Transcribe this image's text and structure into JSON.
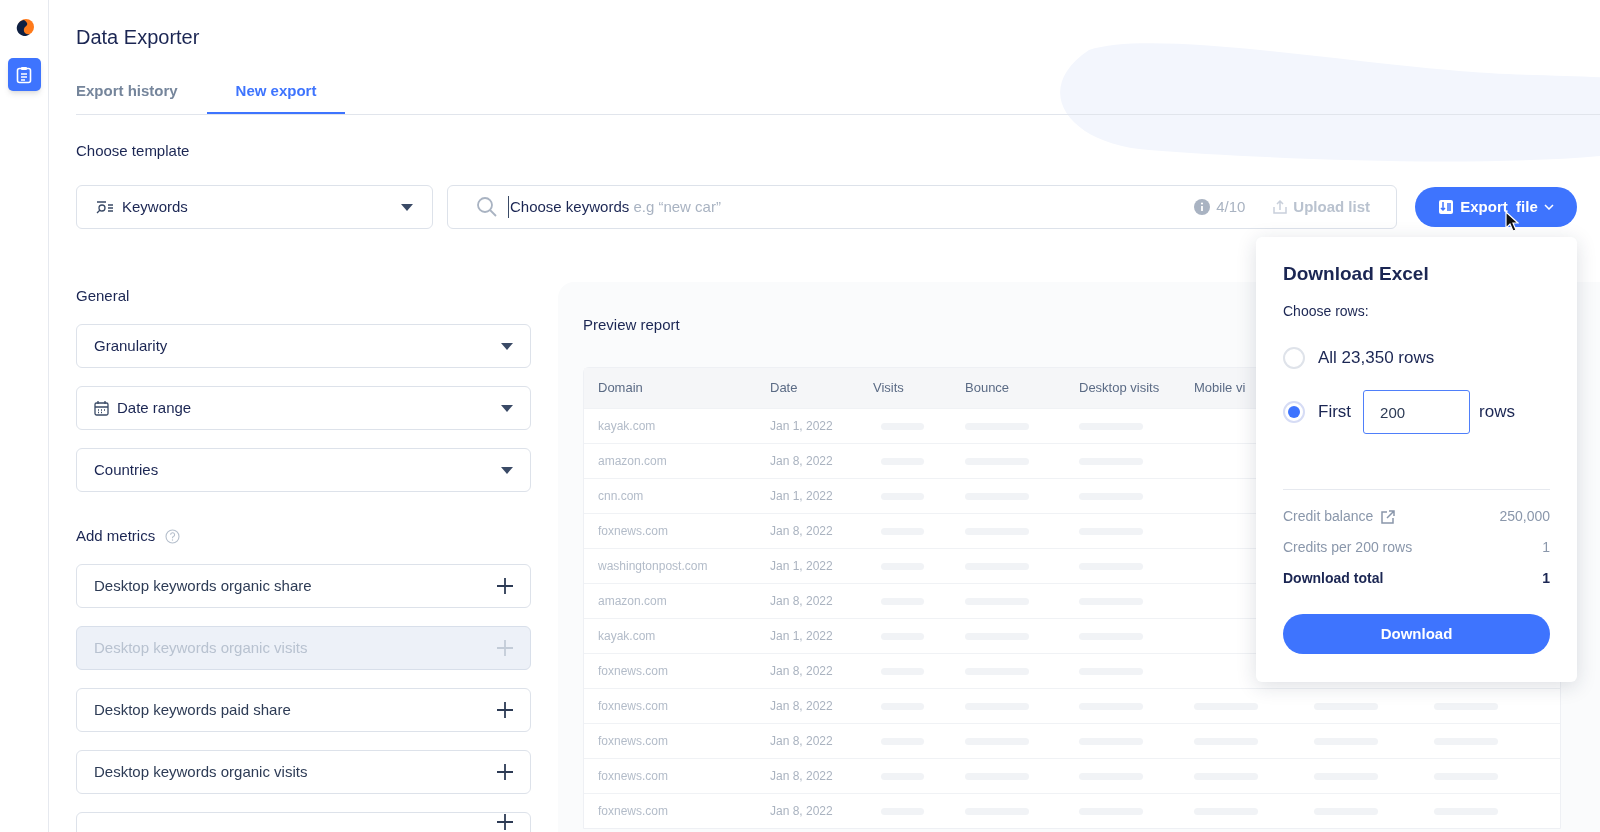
{
  "sidebar": {
    "items": [
      {
        "selected": true
      }
    ]
  },
  "title": "Data Exporter",
  "tabs": [
    {
      "label": "Export history",
      "selected": false
    },
    {
      "label": "New export",
      "selected": true
    }
  ],
  "template": {
    "label": "Choose template",
    "dropdown": {
      "value": "Keywords"
    },
    "search": {
      "placeholder": "Choose keywords",
      "hint": "e.g “new car”",
      "counter": "4/10",
      "upload": {
        "label": "Upload list",
        "disabled": true
      }
    },
    "export_button": "Export  file"
  },
  "general": {
    "label": "General",
    "filters": [
      {
        "label": "Granularity",
        "kind": "plain"
      },
      {
        "label": "Date range",
        "kind": "date"
      },
      {
        "label": "Countries",
        "kind": "plain"
      }
    ]
  },
  "metrics": {
    "label": "Add metrics",
    "items": [
      {
        "label": "Desktop keywords organic share",
        "disabled": false
      },
      {
        "label": "Desktop keywords organic visits",
        "disabled": true
      },
      {
        "label": "Desktop keywords paid share",
        "disabled": false
      },
      {
        "label": "Desktop keywords organic visits",
        "disabled": false
      },
      {
        "disabled": false
      }
    ]
  },
  "preview": {
    "title": "Preview report",
    "columns": [
      "Domain",
      "Date",
      "Visits",
      "Bounce",
      "Desktop visits",
      "Mobile vi"
    ],
    "rows": [
      {
        "domain": "kayak.com",
        "date": "Jan 1, 2022"
      },
      {
        "domain": "amazon.com",
        "date": "Jan 8, 2022"
      },
      {
        "domain": "cnn.com",
        "date": "Jan 1, 2022"
      },
      {
        "domain": "foxnews.com",
        "date": "Jan 8, 2022"
      },
      {
        "domain": "washingtonpost.com",
        "date": "Jan 1, 2022"
      },
      {
        "domain": "amazon.com",
        "date": "Jan 8, 2022"
      },
      {
        "domain": "kayak.com",
        "date": "Jan 1, 2022"
      },
      {
        "domain": "foxnews.com",
        "date": "Jan 8, 2022"
      },
      {
        "domain": "foxnews.com",
        "date": "Jan 8, 2022"
      },
      {
        "domain": "foxnews.com",
        "date": "Jan 8, 2022"
      },
      {
        "domain": "foxnews.com",
        "date": "Jan 8, 2022"
      },
      {
        "domain": "foxnews.com",
        "date": "Jan 8, 2022"
      }
    ]
  },
  "popup": {
    "title": "Download Excel",
    "choose_label": "Choose rows:",
    "options": [
      {
        "kind": "all",
        "label": "All 23,350 rows",
        "selected": false
      },
      {
        "kind": "count",
        "label": "First",
        "value": "200",
        "suffix": "rows",
        "selected": true
      }
    ],
    "summary": [
      {
        "kind": "link",
        "label": "Credit balance",
        "value": "250,000"
      },
      {
        "kind": "plain",
        "label": "Credits per 200 rows",
        "value": "1"
      },
      {
        "kind": "total",
        "label": "Download total",
        "value": "1"
      }
    ],
    "button": "Download"
  }
}
